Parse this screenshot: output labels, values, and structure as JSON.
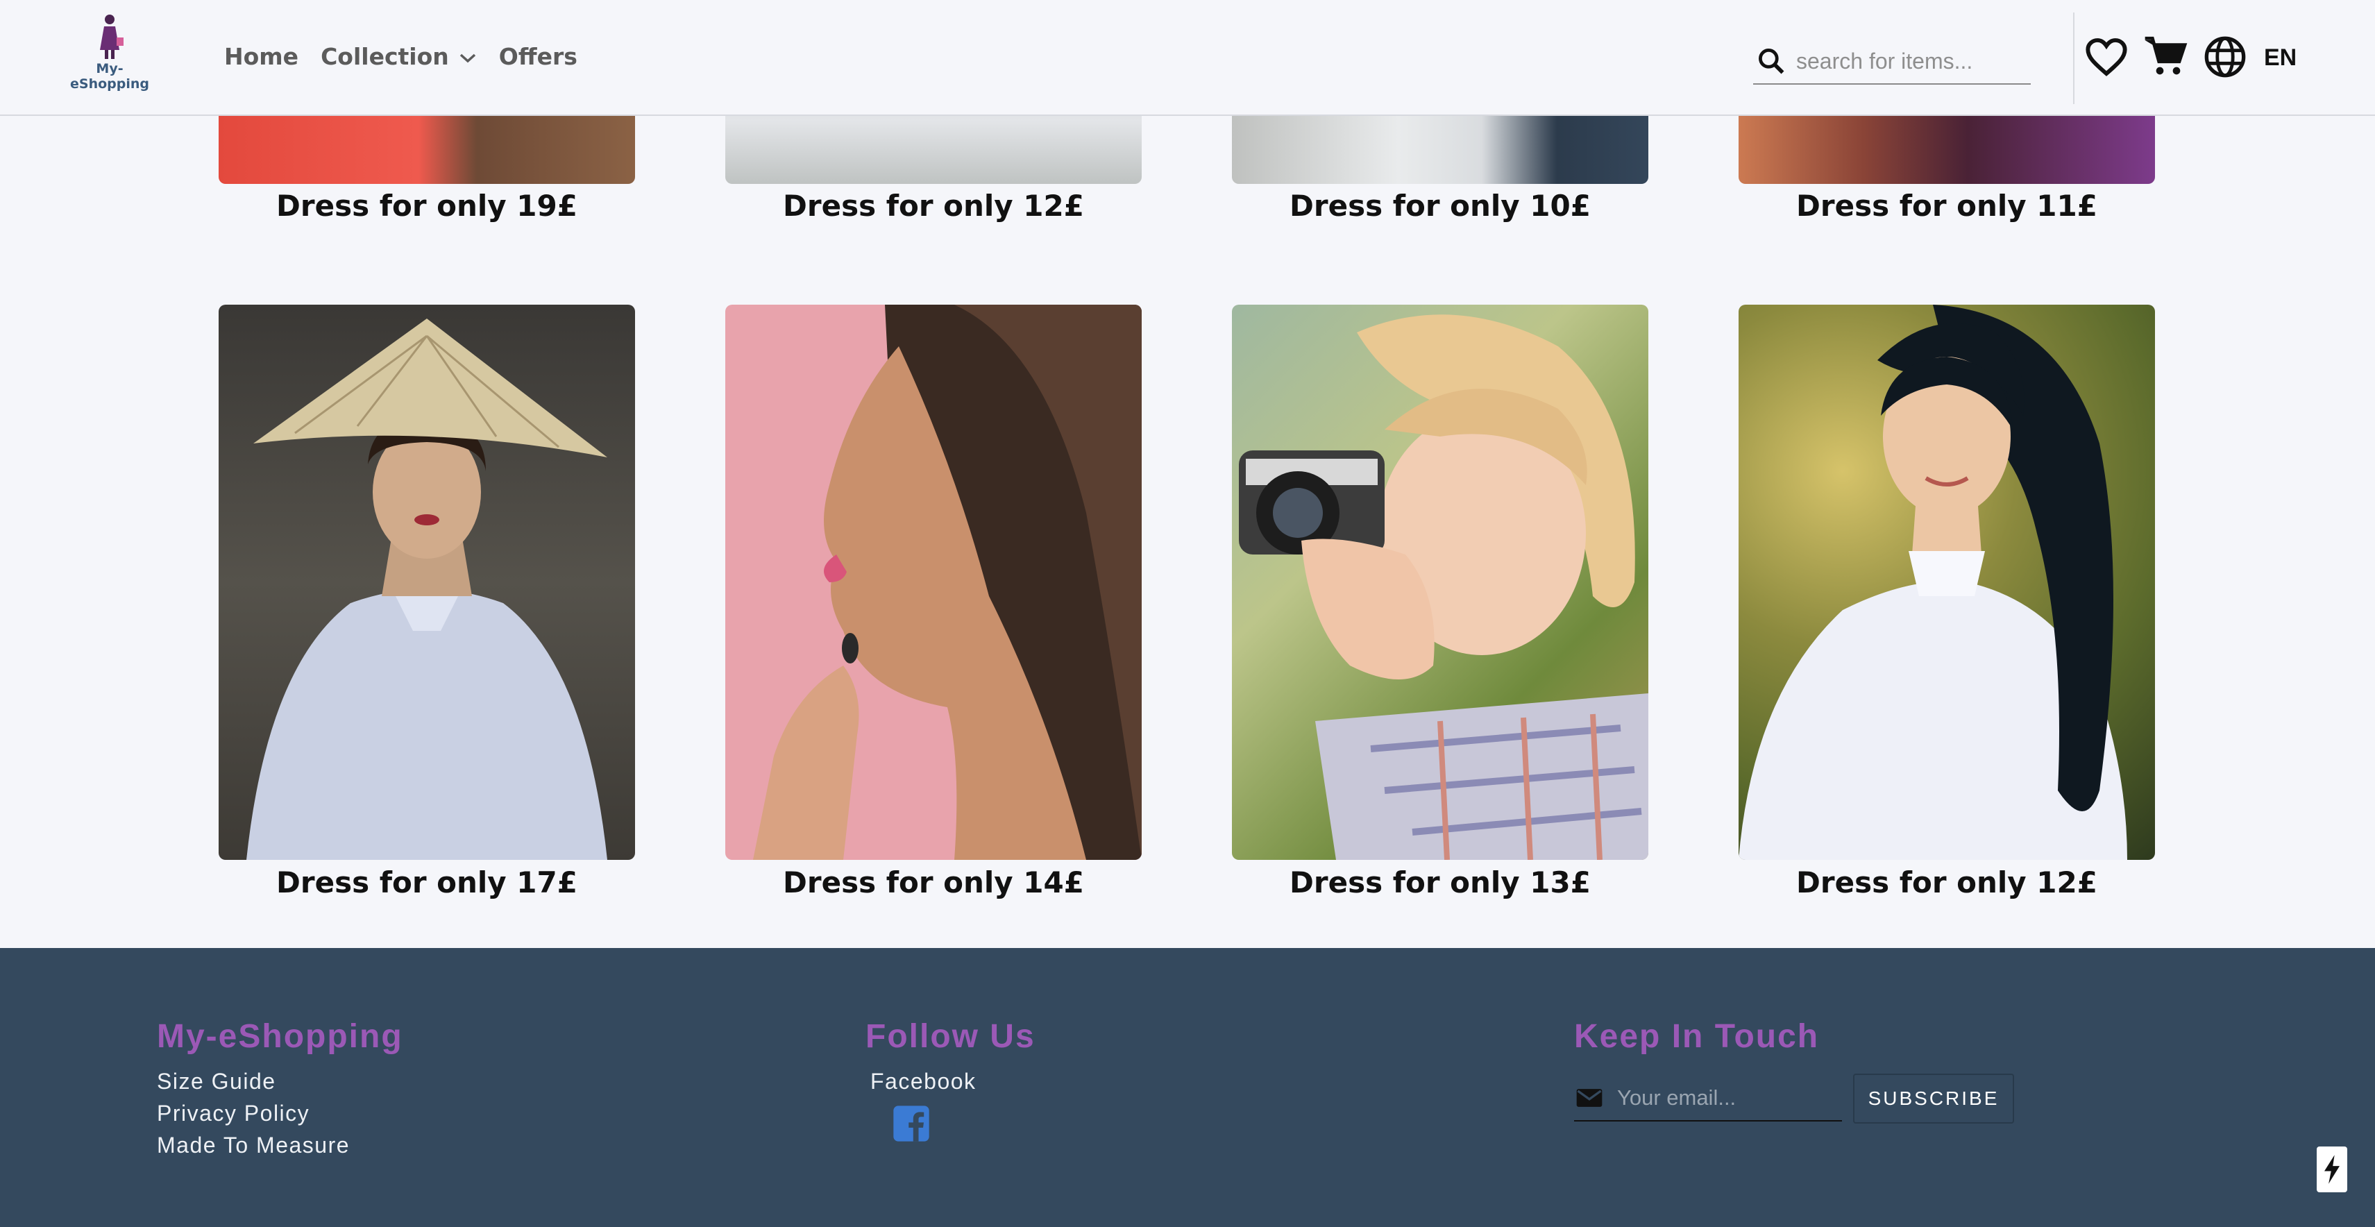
{
  "header": {
    "logo_text": "My-eShopping",
    "nav": [
      {
        "label": "Home"
      },
      {
        "label": "Collection"
      },
      {
        "label": "Offers"
      }
    ],
    "search_placeholder": "search for items...",
    "lang": "EN",
    "icons": [
      "heart-icon",
      "cart-icon",
      "globe-icon",
      "search-icon"
    ]
  },
  "products": {
    "row1": [
      {
        "caption": "Dress for only 19£"
      },
      {
        "caption": "Dress for only 12£"
      },
      {
        "caption": "Dress for only 10£"
      },
      {
        "caption": "Dress for only 11£"
      }
    ],
    "row2": [
      {
        "caption": "Dress for only 17£"
      },
      {
        "caption": "Dress for only 14£"
      },
      {
        "caption": "Dress for only 13£"
      },
      {
        "caption": "Dress for only 12£"
      }
    ]
  },
  "footer": {
    "col1": {
      "title": "My-eShopping",
      "links": [
        "Size Guide",
        "Privacy Policy",
        "Made To Measure"
      ]
    },
    "col2": {
      "title": "Follow Us",
      "links": [
        "Facebook"
      ]
    },
    "col3": {
      "title": "Keep In Touch",
      "email_placeholder": "Your email...",
      "subscribe_label": "SUBSCRIBE"
    }
  },
  "colors": {
    "background": "#f5f6fa",
    "footer": "#34495e",
    "footer_heading": "#9b59b6",
    "facebook": "#3b7bd4"
  }
}
